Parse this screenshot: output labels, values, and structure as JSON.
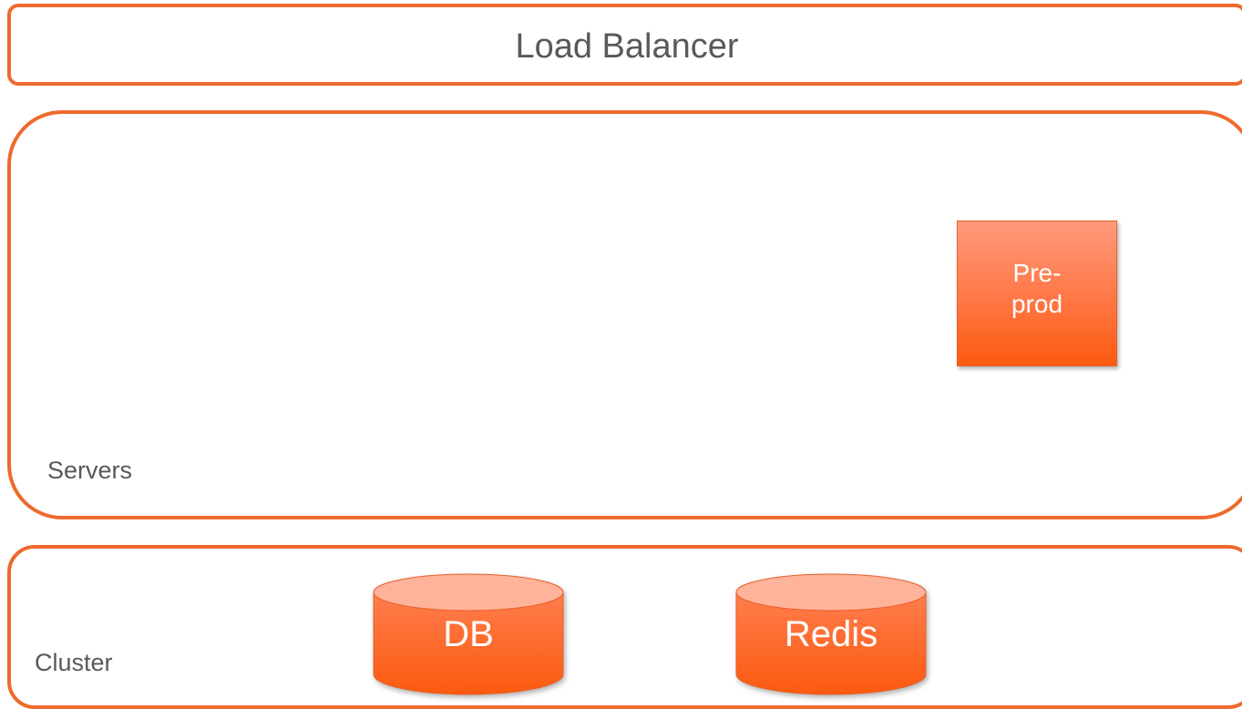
{
  "diagram": {
    "load_balancer": {
      "label": "Load Balancer"
    },
    "servers": {
      "label": "Servers",
      "nodes": [
        {
          "label": "Pre-\nprod"
        }
      ]
    },
    "cluster": {
      "label": "Cluster",
      "stores": [
        {
          "label": "DB"
        },
        {
          "label": "Redis"
        }
      ]
    },
    "colors": {
      "accent": "#ee6a2d",
      "node_fill_top": "#ff9a7c",
      "node_fill_bottom": "#fb5a0f",
      "text": "#595959"
    }
  }
}
